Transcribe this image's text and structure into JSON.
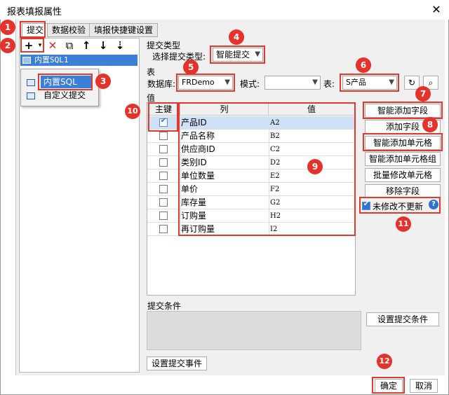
{
  "window": {
    "title": "报表填报属性",
    "close_symbol": "✕"
  },
  "tabs": [
    "提交",
    "数据校验",
    "填报快捷键设置"
  ],
  "toolbar": {
    "add": "+",
    "add_arrow": "▾",
    "delete": "✕",
    "copy": "⧉",
    "up": "↑",
    "down": "↓",
    "sort": "⇣"
  },
  "tree": {
    "selected": "内置SQL1"
  },
  "add_menu": {
    "items": [
      "内置SQL",
      "自定义提交"
    ]
  },
  "submit_type": {
    "group": "提交类型",
    "label": "选择提交类型:",
    "value": "智能提交"
  },
  "table_section": {
    "group": "表",
    "db_label": "数据库:",
    "db_value": "FRDemo",
    "schema_label": "模式:",
    "schema_value": "",
    "table_label": "表:",
    "table_value": "S产品"
  },
  "values_section": {
    "group": "值",
    "headers": [
      "主键",
      "列",
      "值"
    ],
    "rows": [
      {
        "key": true,
        "col": "产品ID",
        "val": "A2"
      },
      {
        "key": false,
        "col": "产品名称",
        "val": "B2"
      },
      {
        "key": false,
        "col": "供应商ID",
        "val": "C2"
      },
      {
        "key": false,
        "col": "类别ID",
        "val": "D2"
      },
      {
        "key": false,
        "col": "单位数量",
        "val": "E2"
      },
      {
        "key": false,
        "col": "单价",
        "val": "F2"
      },
      {
        "key": false,
        "col": "库存量",
        "val": "G2"
      },
      {
        "key": false,
        "col": "订购量",
        "val": "H2"
      },
      {
        "key": false,
        "col": "再订购量",
        "val": "I2"
      }
    ]
  },
  "side_buttons": [
    "智能添加字段",
    "添加字段",
    "智能添加单元格",
    "智能添加单元格组",
    "批量修改单元格",
    "移除字段"
  ],
  "no_update_checkbox": {
    "label": "未修改不更新",
    "checked": true,
    "help": "?"
  },
  "condition": {
    "group": "提交条件",
    "button": "设置提交条件"
  },
  "event_button": "设置提交事件",
  "footer": {
    "ok": "确定",
    "cancel": "取消"
  },
  "badges": [
    "1",
    "2",
    "3",
    "4",
    "5",
    "6",
    "7",
    "8",
    "9",
    "10",
    "11",
    "12"
  ],
  "colors": {
    "annotation": "#e03a2f",
    "selection": "#3c7fd6",
    "badge": "#e5322a"
  }
}
